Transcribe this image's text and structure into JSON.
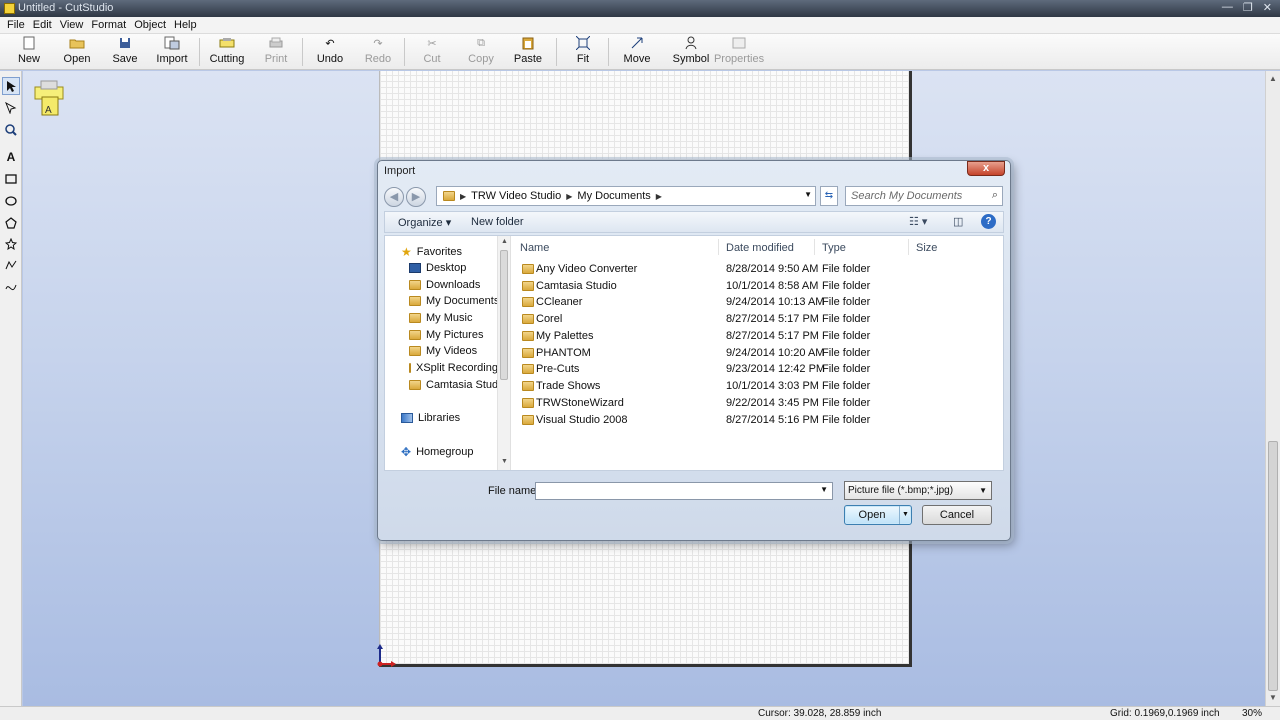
{
  "app": {
    "window_title": "Untitled - CutStudio",
    "window_controls": [
      "—",
      "❐",
      "✕"
    ]
  },
  "menu": [
    "File",
    "Edit",
    "View",
    "Format",
    "Object",
    "Help"
  ],
  "toolbar": {
    "new": "New",
    "open": "Open",
    "save": "Save",
    "import": "Import",
    "cutting": "Cutting",
    "print": "Print",
    "undo": "Undo",
    "redo": "Redo",
    "cut": "Cut",
    "copy": "Copy",
    "paste": "Paste",
    "fit": "Fit",
    "move": "Move",
    "symbol": "Symbol",
    "properties": "Properties"
  },
  "palette_icons": [
    "select-arrow-icon",
    "node-edit-icon",
    "zoom-icon",
    "text-icon",
    "rectangle-icon",
    "ellipse-icon",
    "polygon-icon",
    "star-icon",
    "line-icon",
    "curve-icon"
  ],
  "dialog": {
    "title": "Import",
    "close": "x",
    "breadcrumb": [
      "TRW Video Studio",
      "My Documents"
    ],
    "search_placeholder": "Search My Documents",
    "organize": "Organize ▾",
    "new_folder": "New folder",
    "nav": {
      "favorites": "Favorites",
      "favorites_items": [
        "Desktop",
        "Downloads",
        "My Documents",
        "My Music",
        "My Pictures",
        "My Videos",
        "XSplit Recording:",
        "Camtasia Studio"
      ],
      "libraries": "Libraries",
      "homegroup": "Homegroup"
    },
    "columns": {
      "name": "Name",
      "date": "Date modified",
      "type": "Type",
      "size": "Size"
    },
    "files": [
      {
        "name": "Any Video Converter",
        "date": "8/28/2014 9:50 AM",
        "type": "File folder"
      },
      {
        "name": "Camtasia Studio",
        "date": "10/1/2014 8:58 AM",
        "type": "File folder"
      },
      {
        "name": "CCleaner",
        "date": "9/24/2014 10:13 AM",
        "type": "File folder"
      },
      {
        "name": "Corel",
        "date": "8/27/2014 5:17 PM",
        "type": "File folder"
      },
      {
        "name": "My Palettes",
        "date": "8/27/2014 5:17 PM",
        "type": "File folder"
      },
      {
        "name": "PHANTOM",
        "date": "9/24/2014 10:20 AM",
        "type": "File folder"
      },
      {
        "name": "Pre-Cuts",
        "date": "9/23/2014 12:42 PM",
        "type": "File folder"
      },
      {
        "name": "Trade Shows",
        "date": "10/1/2014 3:03 PM",
        "type": "File folder"
      },
      {
        "name": "TRWStoneWizard",
        "date": "9/22/2014 3:45 PM",
        "type": "File folder"
      },
      {
        "name": "Visual Studio 2008",
        "date": "8/27/2014 5:16 PM",
        "type": "File folder"
      }
    ],
    "file_name_label": "File name:",
    "file_name_value": "",
    "file_type": "Picture file (*.bmp;*.jpg)",
    "open": "Open",
    "cancel": "Cancel"
  },
  "status": {
    "cursor": "Cursor: 39.028, 28.859 inch",
    "grid": "Grid: 0.1969,0.1969 inch",
    "zoom": "30%"
  }
}
